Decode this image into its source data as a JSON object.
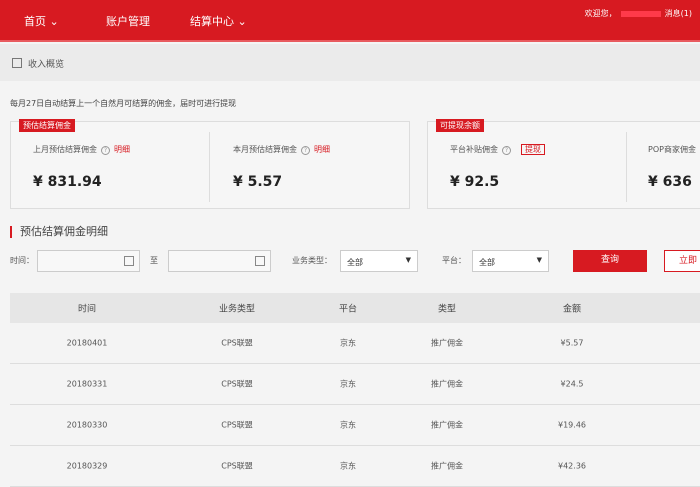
{
  "header": {
    "nav": [
      {
        "label": "首页",
        "caret": true
      },
      {
        "label": "账户管理",
        "caret": false
      },
      {
        "label": "结算中心",
        "caret": true
      }
    ],
    "welcome": "欢迎您，",
    "messages": "消息(1)"
  },
  "breadcrumb": "收入概览",
  "notice": "每月27日自动结算上一个自然月可结算的佣金，届时可进行提现",
  "card_estimate": {
    "tag": "预估结算佣金",
    "items": [
      {
        "label": "上月预估结算佣金",
        "link": "明细",
        "amount": "¥ 831.94"
      },
      {
        "label": "本月预估结算佣金",
        "link": "明细",
        "amount": "¥ 5.57"
      }
    ]
  },
  "card_withdraw": {
    "tag": "可提现余额",
    "items": [
      {
        "label": "平台补贴佣金",
        "button": "提现",
        "amount": "¥ 92.5"
      },
      {
        "label": "POP商家佣金",
        "amount": "¥ 636"
      }
    ]
  },
  "section_title": "预估结算佣金明细",
  "filters": {
    "time_label": "时间：",
    "to_label": "至",
    "biz_label": "业务类型：",
    "biz_value": "全部",
    "platform_label": "平台：",
    "platform_value": "全部",
    "query": "查询",
    "second_button": "立即"
  },
  "table": {
    "headers": [
      "时间",
      "业务类型",
      "平台",
      "类型",
      "金额"
    ],
    "rows": [
      [
        "20180401",
        "CPS联盟",
        "京东",
        "推广佣金",
        "¥5.57"
      ],
      [
        "20180331",
        "CPS联盟",
        "京东",
        "推广佣金",
        "¥24.5"
      ],
      [
        "20180330",
        "CPS联盟",
        "京东",
        "推广佣金",
        "¥19.46"
      ],
      [
        "20180329",
        "CPS联盟",
        "京东",
        "推广佣金",
        "¥42.36"
      ]
    ]
  },
  "colors": {
    "brand": "#d71a21"
  }
}
